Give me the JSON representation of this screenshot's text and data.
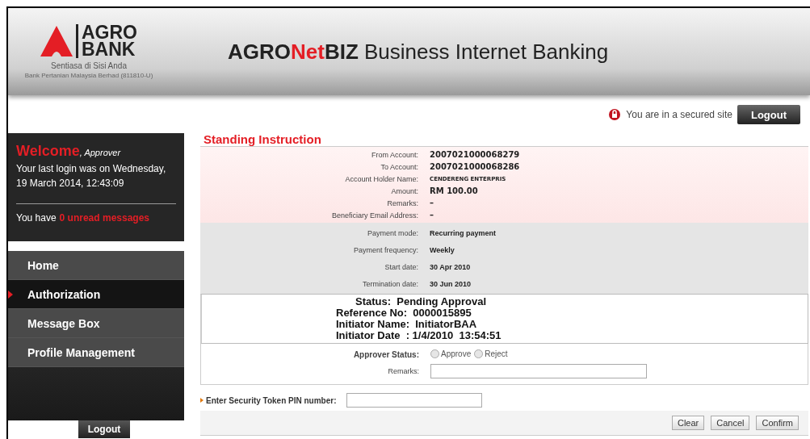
{
  "header": {
    "logo_line1": "AGRO",
    "logo_line2": "BANK",
    "tagline": "Sentiasa di Sisi Anda",
    "company": "Bank Pertanian Malaysia Berhad (811810-U)",
    "title_parts": [
      {
        "text": "AGRO",
        "kind": "dark"
      },
      {
        "text": "Net",
        "kind": "red"
      },
      {
        "text": "BIZ",
        "kind": "dark"
      },
      {
        "text": " Business Internet Banking",
        "kind": "plain"
      }
    ]
  },
  "secure": {
    "text": "You are in a secured site",
    "logout": "Logout"
  },
  "welcome": {
    "greeting": "Welcome",
    "role": ", Approver",
    "last_login": "Your last login was on Wednesday, 19 March 2014, 12:43:09",
    "messages_prefix": "You have ",
    "messages_count": "0 unread messages"
  },
  "menu": [
    {
      "label": "Home",
      "selected": false
    },
    {
      "label": "Authorization",
      "selected": true
    },
    {
      "label": "Message Box",
      "selected": false
    },
    {
      "label": "Profile Management",
      "selected": false
    }
  ],
  "sidebar_logout": "Logout",
  "page_title": "Standing Instruction",
  "account_rows": [
    {
      "label": "From Account:",
      "value": "2007021000068279",
      "kind": "big"
    },
    {
      "label": "To Account:",
      "value": "2007021000068286",
      "kind": "big"
    },
    {
      "label": "Account Holder Name:",
      "value": "CENDERENG ENTERPRIS",
      "kind": "small"
    },
    {
      "label": "Amount:",
      "value": "RM 100.00",
      "kind": "big"
    },
    {
      "label": "Remarks:",
      "value": "–",
      "kind": "big"
    },
    {
      "label": "Beneficiary Email Address:",
      "value": "–",
      "kind": "big"
    }
  ],
  "payment_rows": [
    {
      "label": "Payment mode:",
      "value": "Recurring payment"
    },
    {
      "label": "Payment frequency:",
      "value": "Weekly"
    },
    {
      "label": "Start date:",
      "value": "30 Apr 2010"
    },
    {
      "label": "Termination date:",
      "value": "30 Jun 2010"
    }
  ],
  "status_lines": [
    {
      "label": "Status:",
      "value": "Pending Approval",
      "kind": "center"
    },
    {
      "label": "Reference No:",
      "value": "0000015895",
      "kind": "left"
    },
    {
      "label": "Initiator Name:",
      "value": "InitiatorBAA",
      "kind": "left"
    },
    {
      "label": "Initiator Date",
      "value": ": 1/4/2010  13:54:51",
      "kind": "left"
    }
  ],
  "approver_status": {
    "label": "Approver Status:",
    "options": [
      {
        "label": "Approve",
        "selected": false
      },
      {
        "label": "Reject",
        "selected": false
      }
    ]
  },
  "remarks_label": "Remarks:",
  "token_label": "Enter Security Token PIN number:",
  "buttons": [
    "Clear",
    "Cancel",
    "Confirm"
  ]
}
